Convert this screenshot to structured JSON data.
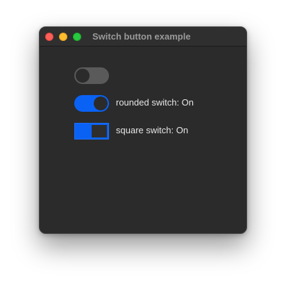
{
  "window": {
    "title": "Switch button example",
    "traffic_lights": {
      "close": "#fe5f57",
      "minimize": "#febc2e",
      "zoom": "#28c840"
    }
  },
  "switches": [
    {
      "style": "rounded",
      "state": "off",
      "label": ""
    },
    {
      "style": "rounded",
      "state": "on",
      "label": "rounded switch: On"
    },
    {
      "style": "square",
      "state": "on",
      "label": "square switch: On"
    }
  ],
  "colors": {
    "accent": "#0a62f5",
    "window_bg": "#2b2b2b",
    "off_track": "#5a5a5a",
    "text": "#e6e6e6"
  }
}
